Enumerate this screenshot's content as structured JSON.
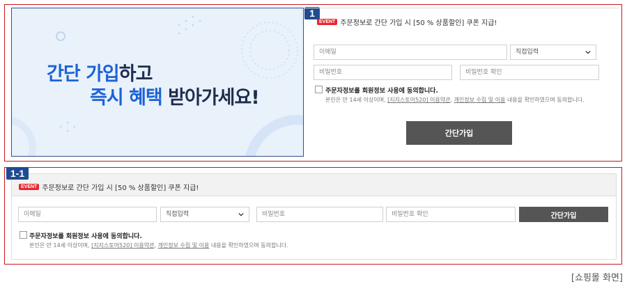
{
  "frame1": {
    "badge": "1",
    "banner": {
      "line1_blue": "간단 가입",
      "line1_dark": "하고",
      "line2_blue": "즉시 혜택",
      "line2_dark": " 받아가세요!"
    },
    "event_tag": "EVENT",
    "event_text": "주문정보로 간단 가입 시 [50 % 상품할인] 쿠폰 지급!",
    "email_placeholder": "이메일",
    "domain_select": "직접입력",
    "password_placeholder": "비밀번호",
    "password_confirm_placeholder": "비밀번호 확인",
    "agree_title": "주문자정보를 회원정보 사용에 동의합니다.",
    "agree_desc_pre": "본인은 만 14세 이상이며, ",
    "agree_terms": "[지지스토어520] 이용약관",
    "agree_sep": ", ",
    "agree_privacy": "개인정보 수집 및 이용",
    "agree_desc_post": " 내용을 확인하였으며 동의합니다.",
    "submit": "간단가입"
  },
  "frame2": {
    "badge": "1-1",
    "event_tag": "EVENT",
    "event_text": "주문정보로 간단 가입 시 [50 % 상품할인] 쿠폰 지급!",
    "email_placeholder": "이메일",
    "domain_select": "직접입력",
    "password_placeholder": "비밀번호",
    "password_confirm_placeholder": "비밀번호 확인",
    "submit": "간단가입",
    "agree_title": "주문자정보를 회원정보 사용에 동의합니다.",
    "agree_desc_pre": "본인은 만 14세 이상이며, ",
    "agree_terms": "[지지스토어520] 이용약관",
    "agree_sep": ", ",
    "agree_privacy": "개인정보 수집 및 이용",
    "agree_desc_post": " 내용을 확인하였으며 동의합니다."
  },
  "caption": "[쇼핑몰 화면]",
  "colors": {
    "accent_red": "#c8161d",
    "badge_blue": "#1f4c91",
    "event_red": "#e8262d",
    "button_gray": "#555555"
  }
}
